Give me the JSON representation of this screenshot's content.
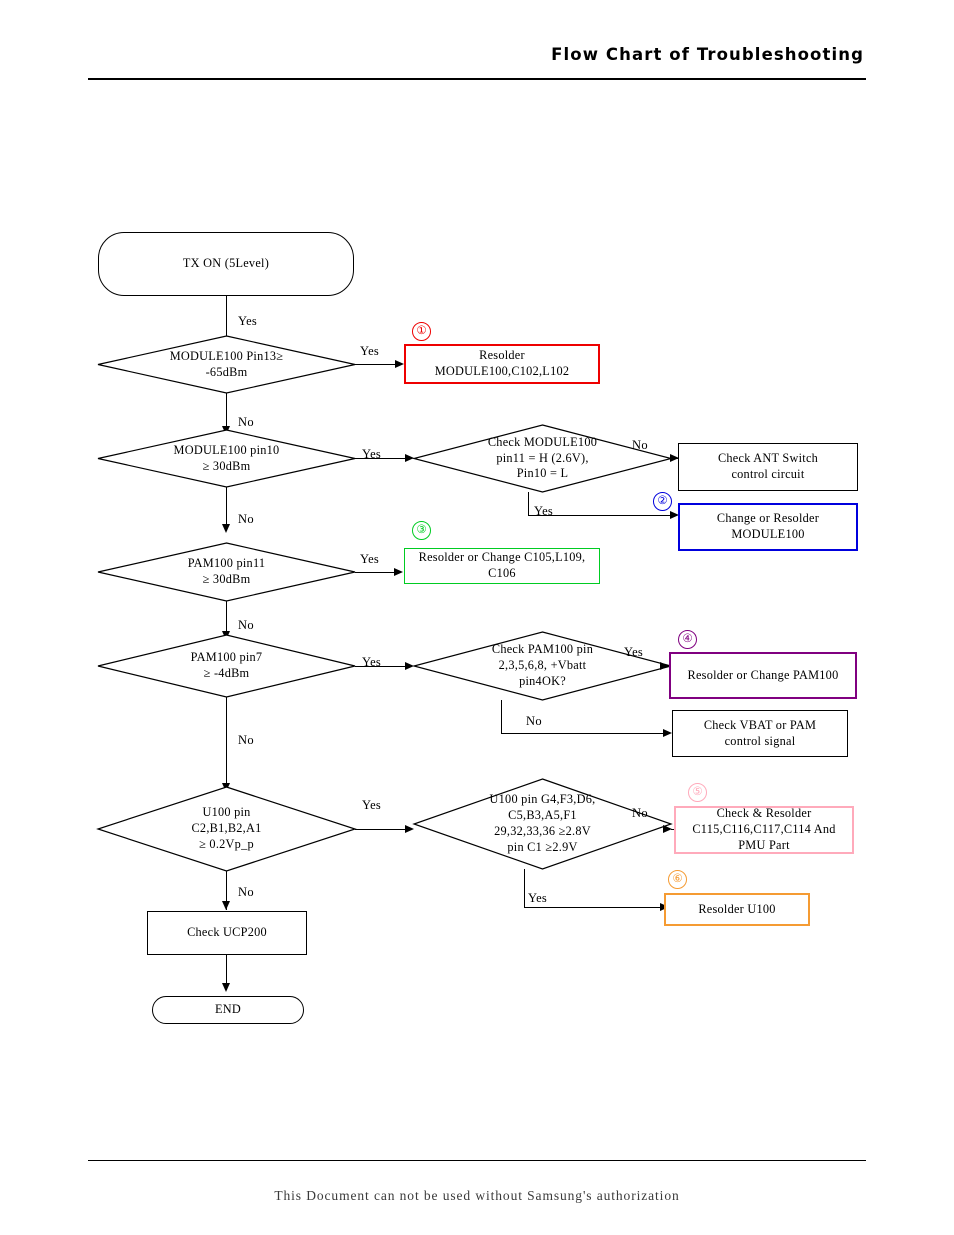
{
  "header": {
    "title": "Flow Chart of Troubleshooting"
  },
  "footer": {
    "text": "This Document can not be used without Samsung's authorization"
  },
  "colors": {
    "default": "#000000",
    "marker1": "#ee0000",
    "marker2": "#0000dd",
    "marker3": "#00cc22",
    "marker4": "#800080",
    "marker5": "#ffaabb",
    "marker6": "#f59b33"
  },
  "chart_data": {
    "type": "diagram",
    "title": "Flow Chart of Troubleshooting",
    "nodes": [
      {
        "id": "start",
        "shape": "terminator",
        "text": "TX ON (5Level)"
      },
      {
        "id": "d1",
        "shape": "diamond",
        "text": "MODULE100 Pin13≥\n-65dBm"
      },
      {
        "id": "a1",
        "shape": "rect",
        "text": "Resolder\nMODULE100,C102,L102",
        "color": "#ee0000",
        "marker": "①"
      },
      {
        "id": "d2",
        "shape": "diamond",
        "text": "MODULE100 pin10\n≥ 30dBm"
      },
      {
        "id": "d2b",
        "shape": "diamond",
        "text": "Check MODULE100\npin11 = H (2.6V),\nPin10 = L"
      },
      {
        "id": "a2a",
        "shape": "rect",
        "text": "Check ANT Switch\ncontrol circuit",
        "color": "#000000"
      },
      {
        "id": "a2b",
        "shape": "rect",
        "text": "Change or Resolder\nMODULE100",
        "color": "#0000dd",
        "marker": "②"
      },
      {
        "id": "d3",
        "shape": "diamond",
        "text": "PAM100 pin11\n≥ 30dBm"
      },
      {
        "id": "a3",
        "shape": "rect",
        "text": "Resolder or Change C105,L109,\nC106",
        "color": "#00cc22",
        "marker": "③"
      },
      {
        "id": "d4",
        "shape": "diamond",
        "text": "PAM100 pin7\n≥ -4dBm"
      },
      {
        "id": "d4b",
        "shape": "diamond",
        "text": "Check PAM100 pin\n2,3,5,6,8, +Vbatt\npin4OK?"
      },
      {
        "id": "a4a",
        "shape": "rect",
        "text": "Resolder or Change PAM100",
        "color": "#800080",
        "marker": "④"
      },
      {
        "id": "a4b",
        "shape": "rect",
        "text": "Check VBAT or PAM\ncontrol signal",
        "color": "#000000"
      },
      {
        "id": "d5",
        "shape": "diamond",
        "text": "U100 pin\nC2,B1,B2,A1\n≥ 0.2Vp_p"
      },
      {
        "id": "d5b",
        "shape": "diamond",
        "text": "U100 pin G4,F3,D6,\nC5,B3,A5,F1\n29,32,33,36 ≥2.8V\npin C1 ≥2.9V"
      },
      {
        "id": "a5a",
        "shape": "rect",
        "text": "Check & Resolder\nC115,C116,C117,C114 And\nPMU Part",
        "color": "#ffaabb",
        "marker": "⑤"
      },
      {
        "id": "a5b",
        "shape": "rect",
        "text": "Resolder U100",
        "color": "#f59b33",
        "marker": "⑥"
      },
      {
        "id": "ucp",
        "shape": "rect",
        "text": "Check UCP200",
        "color": "#000000"
      },
      {
        "id": "end",
        "shape": "terminator",
        "text": "END"
      }
    ],
    "edges": [
      {
        "from": "start",
        "to": "d1",
        "label": "Yes"
      },
      {
        "from": "d1",
        "to": "a1",
        "label": "Yes"
      },
      {
        "from": "d1",
        "to": "d2",
        "label": "No"
      },
      {
        "from": "d2",
        "to": "d2b",
        "label": "Yes"
      },
      {
        "from": "d2b",
        "to": "a2a",
        "label": "No"
      },
      {
        "from": "d2b",
        "to": "a2b",
        "label": "Yes"
      },
      {
        "from": "d2",
        "to": "d3",
        "label": "No"
      },
      {
        "from": "d3",
        "to": "a3",
        "label": "Yes"
      },
      {
        "from": "d3",
        "to": "d4",
        "label": "No"
      },
      {
        "from": "d4",
        "to": "d4b",
        "label": "Yes"
      },
      {
        "from": "d4b",
        "to": "a4a",
        "label": "Yes"
      },
      {
        "from": "d4b",
        "to": "a4b",
        "label": "No"
      },
      {
        "from": "d4",
        "to": "d5",
        "label": "No"
      },
      {
        "from": "d5",
        "to": "d5b",
        "label": "Yes"
      },
      {
        "from": "d5b",
        "to": "a5a",
        "label": "No"
      },
      {
        "from": "d5b",
        "to": "a5b",
        "label": "Yes"
      },
      {
        "from": "d5",
        "to": "ucp",
        "label": "No"
      },
      {
        "from": "ucp",
        "to": "end",
        "label": ""
      }
    ]
  },
  "labels": {
    "yes": "Yes",
    "no": "No"
  },
  "markers": {
    "m1": "①",
    "m2": "②",
    "m3": "③",
    "m4": "④",
    "m5": "⑤",
    "m6": "⑥"
  }
}
